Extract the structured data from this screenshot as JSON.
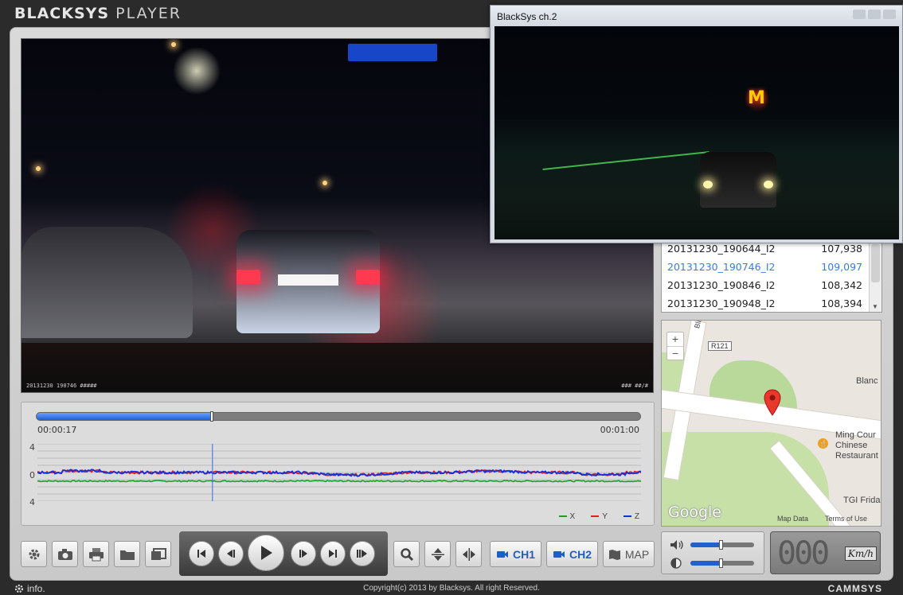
{
  "app": {
    "title_bold": "BLACKSYS",
    "title_light": "PLAYER"
  },
  "video1": {
    "overlay_left": "20131230 190746 #####",
    "overlay_right": "### ##/#"
  },
  "popup": {
    "title": "BlackSys ch.2",
    "sign": "M"
  },
  "file_list": {
    "rows": [
      {
        "name": "20131230_190644_I2",
        "size": "107,938",
        "selected": false
      },
      {
        "name": "20131230_190746_I2",
        "size": "109,097",
        "selected": true
      },
      {
        "name": "20131230_190846_I2",
        "size": "108,342",
        "selected": false
      },
      {
        "name": "20131230_190948_I2",
        "size": "108,394",
        "selected": false
      }
    ]
  },
  "map": {
    "route": "R121",
    "street": "Blanchardstown",
    "place1": "Blanc",
    "place2_line1": "Ming Cour",
    "place2_line2": "Chinese",
    "place2_line3": "Restaurant",
    "place3": "TGI Frida",
    "logo": "Google",
    "map_data": "Map Data",
    "terms": "Terms of Use",
    "zoom_in": "+",
    "zoom_out": "−"
  },
  "playback": {
    "current_time": "00:00:17",
    "end_time": "00:01:00",
    "progress_fraction": 0.29
  },
  "chart_data": {
    "type": "line",
    "yticks": [
      "4",
      "0",
      "4"
    ],
    "ylim": [
      -4,
      4
    ],
    "series": [
      {
        "name": "X",
        "color": "#1e9e2e",
        "baseline": -1.2
      },
      {
        "name": "Y",
        "color": "#e02020",
        "baseline": 0
      },
      {
        "name": "Z",
        "color": "#1030e0",
        "baseline": 0
      }
    ],
    "cursor_fraction": 0.29
  },
  "controls": {
    "ch1": "CH1",
    "ch2": "CH2",
    "map": "MAP",
    "volume_level": 0.48,
    "brightness_level": 0.48
  },
  "speed": {
    "value": "000",
    "unit": "Km/h"
  },
  "footer": {
    "info": "info.",
    "copyright": "Copyright(c) 2013 by Blacksys. All right Reserved.",
    "brand": "CAMMSYS"
  }
}
